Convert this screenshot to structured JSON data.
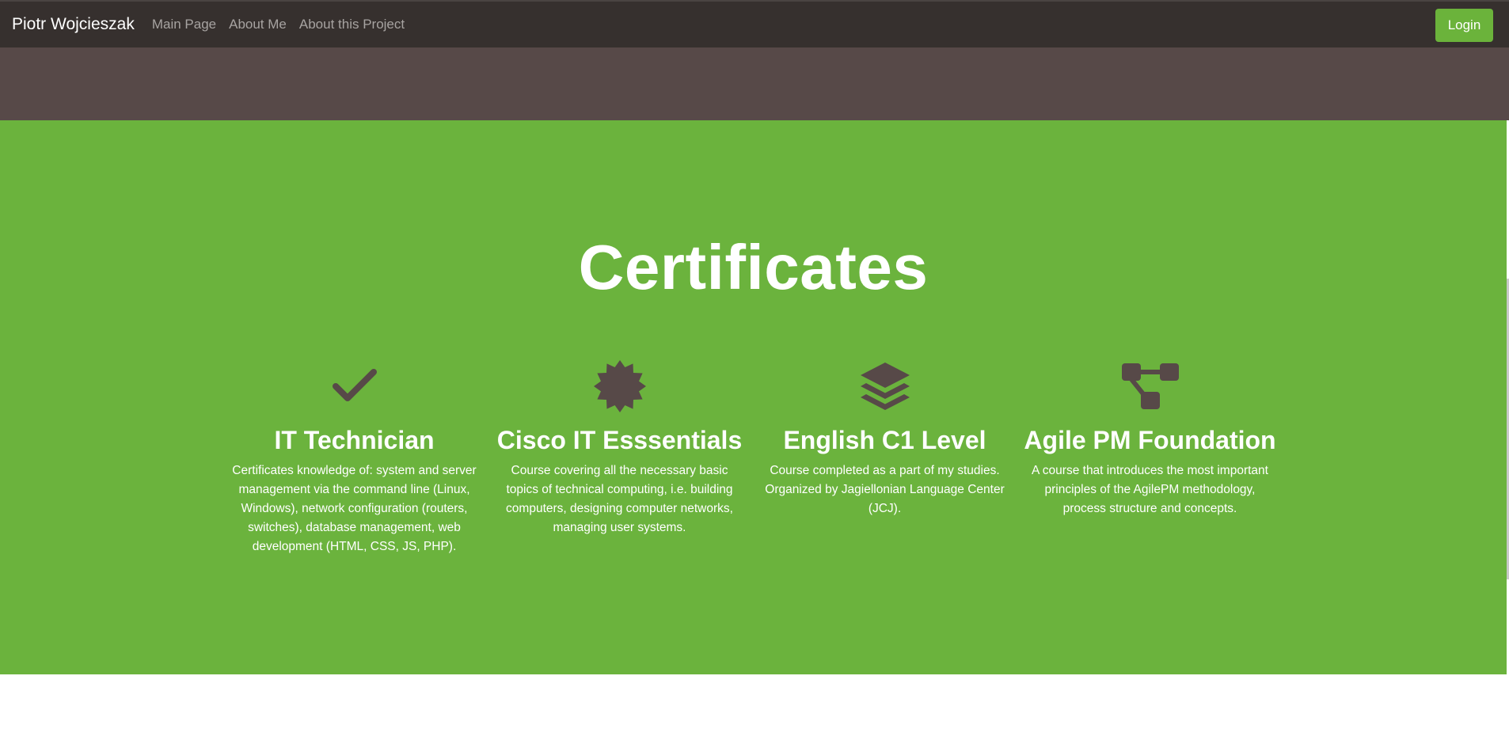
{
  "navbar": {
    "brand": "Piotr Wojcieszak",
    "links": [
      "Main Page",
      "About Me",
      "About this Project"
    ],
    "login_label": "Login"
  },
  "colors": {
    "navbar_bg": "#36302e",
    "header_band": "#574948",
    "section_green": "#6bb33d",
    "icon_color": "#574948",
    "login_button": "#6bb33b"
  },
  "certificates": {
    "title": "Certificates",
    "items": [
      {
        "icon": "checkmark-icon",
        "name": "IT Technician",
        "description": "Certificates knowledge of: system and server management via the command line (Linux, Windows), network configuration (routers, switches), database management, web development (HTML, CSS, JS, PHP)."
      },
      {
        "icon": "badge-icon",
        "name": "Cisco IT Esssentials",
        "description": "Course covering all the necessary basic topics of technical computing, i.e. building computers, designing computer networks, managing user systems."
      },
      {
        "icon": "layers-icon",
        "name": "English C1 Level",
        "description": "Course completed as a part of my studies. Organized by Jagiellonian Language Center (JCJ)."
      },
      {
        "icon": "diagram-icon",
        "name": "Agile PM Foundation",
        "description": "A course that introduces the most important principles of the AgilePM methodology, process structure and concepts."
      }
    ]
  }
}
